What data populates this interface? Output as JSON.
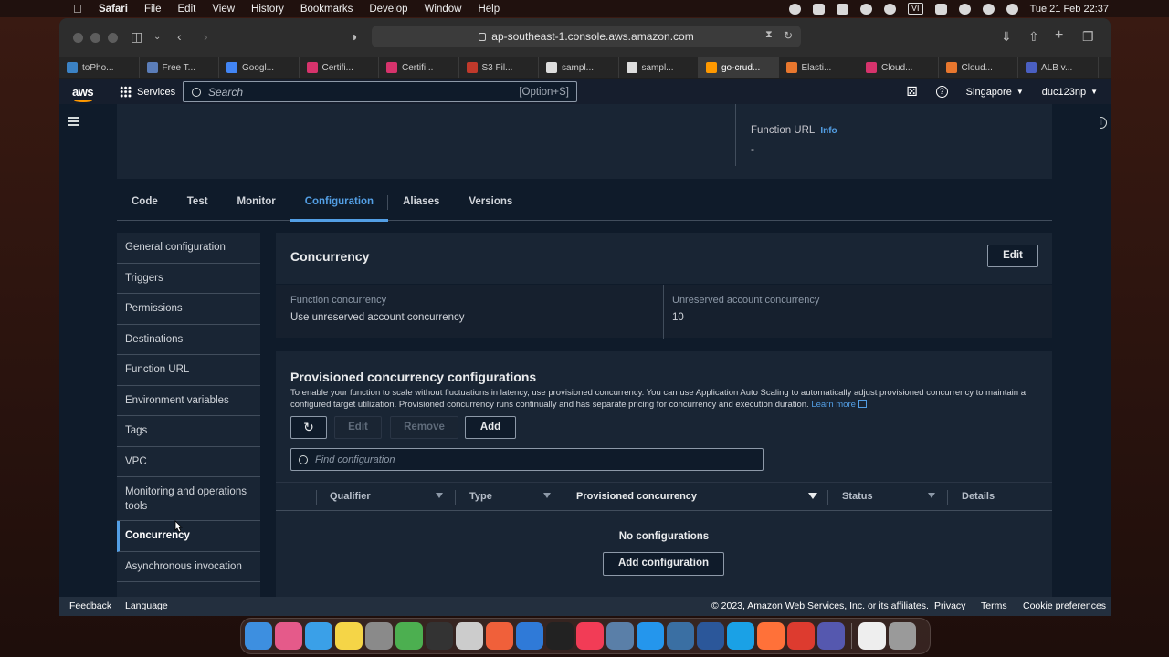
{
  "menubar": {
    "app": "Safari",
    "items": [
      "File",
      "Edit",
      "View",
      "History",
      "Bookmarks",
      "Develop",
      "Window",
      "Help"
    ],
    "vi_badge": "VI",
    "clock": "Tue 21 Feb  22:37"
  },
  "browser": {
    "url": "ap-southeast-1.console.aws.amazon.com",
    "tabs": [
      {
        "label": "toPho...",
        "color": "#3b82c4"
      },
      {
        "label": "Free T...",
        "color": "#5b7db8"
      },
      {
        "label": "Googl...",
        "color": "#4285f4"
      },
      {
        "label": "Certifi...",
        "color": "#d6336c"
      },
      {
        "label": "Certifi...",
        "color": "#d6336c"
      },
      {
        "label": "S3 Fil...",
        "color": "#c0392b"
      },
      {
        "label": "sampl...",
        "color": "#dddddd"
      },
      {
        "label": "sampl...",
        "color": "#dddddd"
      },
      {
        "label": "go-crud...",
        "color": "#ff9900"
      },
      {
        "label": "Elasti...",
        "color": "#e8772e"
      },
      {
        "label": "Cloud...",
        "color": "#d6336c"
      },
      {
        "label": "Cloud...",
        "color": "#e8772e"
      },
      {
        "label": "ALB v...",
        "color": "#4a5fc1"
      }
    ],
    "active_tab": 8
  },
  "aws_nav": {
    "logo": "aws",
    "services": "Services",
    "search_placeholder": "Search",
    "search_shortcut": "[Option+S]",
    "region": "Singapore",
    "account": "duc123np"
  },
  "top_panel": {
    "function_url_label": "Function URL",
    "info": "Info",
    "function_url_value": "-"
  },
  "tabs": [
    "Code",
    "Test",
    "Monitor",
    "Configuration",
    "Aliases",
    "Versions"
  ],
  "active_tab": "Configuration",
  "side_menu": [
    "General configuration",
    "Triggers",
    "Permissions",
    "Destinations",
    "Function URL",
    "Environment variables",
    "Tags",
    "VPC",
    "Monitoring and operations tools",
    "Concurrency",
    "Asynchronous invocation"
  ],
  "active_side": "Concurrency",
  "concurrency": {
    "title": "Concurrency",
    "edit": "Edit",
    "function_concurrency_label": "Function concurrency",
    "function_concurrency_value": "Use unreserved account concurrency",
    "unreserved_label": "Unreserved account concurrency",
    "unreserved_value": "10"
  },
  "provisioned": {
    "title": "Provisioned concurrency configurations",
    "description": "To enable your function to scale without fluctuations in latency, use provisioned concurrency. You can use Application Auto Scaling to automatically adjust provisioned concurrency to maintain a configured target utilization. Provisioned concurrency runs continually and has separate pricing for concurrency and execution duration.",
    "learn_more": "Learn more",
    "buttons": {
      "edit": "Edit",
      "remove": "Remove",
      "add": "Add"
    },
    "find_placeholder": "Find configuration",
    "columns": [
      "Qualifier",
      "Type",
      "Provisioned concurrency",
      "Status",
      "Details"
    ],
    "empty_text": "No configurations",
    "add_configuration": "Add configuration"
  },
  "footer": {
    "feedback": "Feedback",
    "language": "Language",
    "copyright": "© 2023, Amazon Web Services, Inc. or its affiliates.",
    "privacy": "Privacy",
    "terms": "Terms",
    "cookie": "Cookie preferences"
  },
  "dock_colors": [
    "#3d8fe0",
    "#e55a8a",
    "#3aa0e8",
    "#f5d547",
    "#8a8a8a",
    "#4caf50",
    "#333333",
    "#cccccc",
    "#f0603a",
    "#2f7ad8",
    "#222222",
    "#f23c56",
    "#5a7fa8",
    "#2496ed",
    "#3a6fa3",
    "#2b579a",
    "#1aa1e6",
    "#ff7139",
    "#dd3b2f",
    "#5558af",
    "#eeeeee",
    "#9a9a9a"
  ],
  "colors": {
    "accent": "#539fe5",
    "nav_bg": "#161e2d",
    "content_bg": "#0f1b2a",
    "card_bg": "#192534"
  }
}
